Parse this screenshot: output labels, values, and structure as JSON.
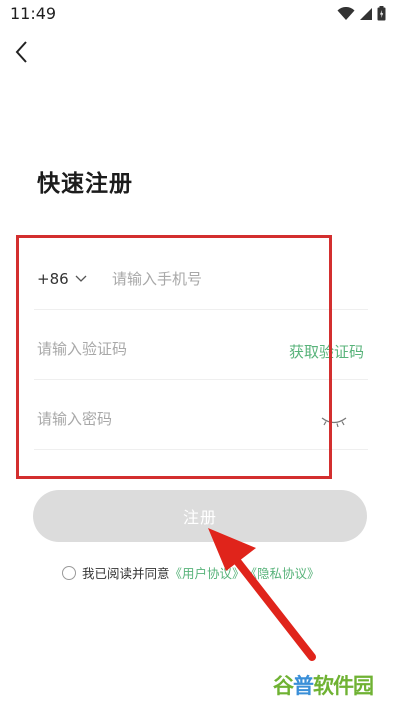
{
  "status_bar": {
    "time": "11:49",
    "icons": [
      "wifi-icon",
      "signal-icon",
      "battery-icon"
    ]
  },
  "header": {
    "back_icon": "back-chevron-icon"
  },
  "title": "快速注册",
  "form": {
    "country_code": "+86",
    "phone_placeholder": "请输入手机号",
    "code_placeholder": "请输入验证码",
    "get_code_label": "获取验证码",
    "password_placeholder": "请输入密码",
    "password_toggle_icon": "eye-closed-icon"
  },
  "register_button": "注册",
  "agreement": {
    "prefix": "我已阅读并同意",
    "user_agreement": "《用户协议》",
    "privacy_policy": "《隐私协议》",
    "checked": false
  },
  "watermark": {
    "part1": "谷",
    "part2": "普",
    "part3": "软件园"
  },
  "colors": {
    "accent_green": "#58b37a",
    "annotation_red": "#d32f2f",
    "button_disabled": "#dcdcdc"
  }
}
